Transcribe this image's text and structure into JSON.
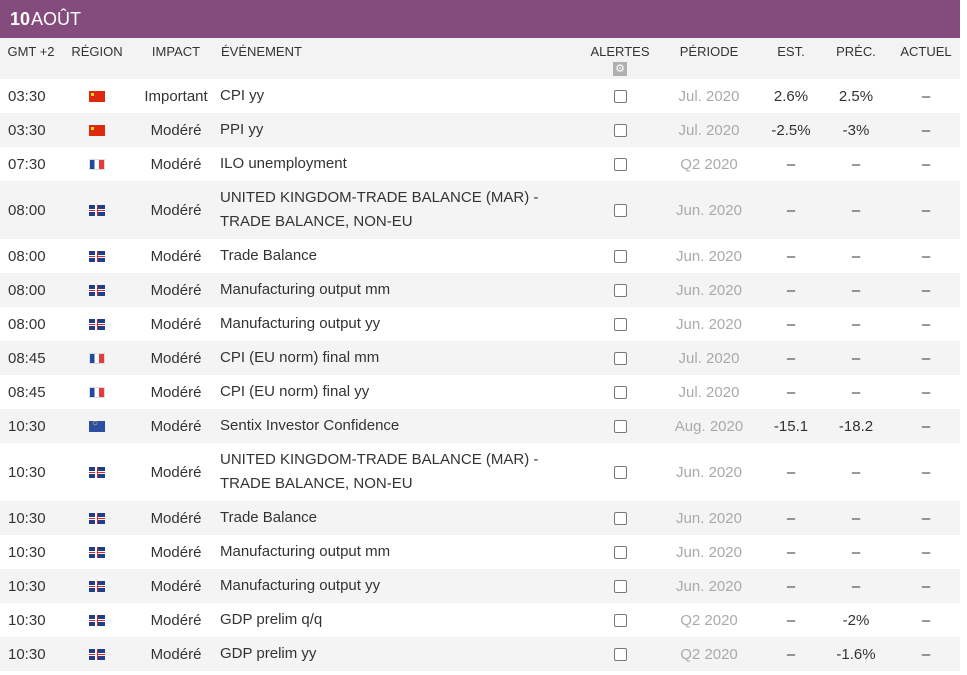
{
  "date": {
    "day": "10",
    "month": "AOÛT"
  },
  "headers": {
    "time": "GMT +2",
    "region": "RÉGION",
    "impact": "IMPACT",
    "event": "ÉVÉNEMENT",
    "alerts": "ALERTES",
    "period": "PÉRIODE",
    "est": "EST.",
    "prev": "PRÉC.",
    "actual": "ACTUEL"
  },
  "rows": [
    {
      "time": "03:30",
      "flag": "cn",
      "impact": "Important",
      "event": "CPI yy",
      "period": "Jul. 2020",
      "est": "2.6%",
      "prev": "2.5%",
      "actual": "–"
    },
    {
      "time": "03:30",
      "flag": "cn",
      "impact": "Modéré",
      "event": "PPI yy",
      "period": "Jul. 2020",
      "est": "-2.5%",
      "prev": "-3%",
      "actual": "–"
    },
    {
      "time": "07:30",
      "flag": "fr",
      "impact": "Modéré",
      "event": "ILO unemployment",
      "period": "Q2 2020",
      "est": "–",
      "prev": "–",
      "actual": "–"
    },
    {
      "time": "08:00",
      "flag": "gb",
      "impact": "Modéré",
      "event": "UNITED KINGDOM-TRADE BALANCE (MAR) - TRADE BALANCE, NON-EU",
      "period": "Jun. 2020",
      "est": "–",
      "prev": "–",
      "actual": "–",
      "tall": true
    },
    {
      "time": "08:00",
      "flag": "gb",
      "impact": "Modéré",
      "event": "Trade Balance",
      "period": "Jun. 2020",
      "est": "–",
      "prev": "–",
      "actual": "–"
    },
    {
      "time": "08:00",
      "flag": "gb",
      "impact": "Modéré",
      "event": "Manufacturing output mm",
      "period": "Jun. 2020",
      "est": "–",
      "prev": "–",
      "actual": "–"
    },
    {
      "time": "08:00",
      "flag": "gb",
      "impact": "Modéré",
      "event": "Manufacturing output yy",
      "period": "Jun. 2020",
      "est": "–",
      "prev": "–",
      "actual": "–"
    },
    {
      "time": "08:45",
      "flag": "fr",
      "impact": "Modéré",
      "event": "CPI (EU norm) final mm",
      "period": "Jul. 2020",
      "est": "–",
      "prev": "–",
      "actual": "–"
    },
    {
      "time": "08:45",
      "flag": "fr",
      "impact": "Modéré",
      "event": "CPI (EU norm) final yy",
      "period": "Jul. 2020",
      "est": "–",
      "prev": "–",
      "actual": "–"
    },
    {
      "time": "10:30",
      "flag": "eu",
      "impact": "Modéré",
      "event": "Sentix Investor Confidence",
      "period": "Aug. 2020",
      "est": "-15.1",
      "prev": "-18.2",
      "actual": "–"
    },
    {
      "time": "10:30",
      "flag": "gb",
      "impact": "Modéré",
      "event": "UNITED KINGDOM-TRADE BALANCE (MAR) - TRADE BALANCE, NON-EU",
      "period": "Jun. 2020",
      "est": "–",
      "prev": "–",
      "actual": "–",
      "tall": true
    },
    {
      "time": "10:30",
      "flag": "gb",
      "impact": "Modéré",
      "event": "Trade Balance",
      "period": "Jun. 2020",
      "est": "–",
      "prev": "–",
      "actual": "–"
    },
    {
      "time": "10:30",
      "flag": "gb",
      "impact": "Modéré",
      "event": "Manufacturing output mm",
      "period": "Jun. 2020",
      "est": "–",
      "prev": "–",
      "actual": "–"
    },
    {
      "time": "10:30",
      "flag": "gb",
      "impact": "Modéré",
      "event": "Manufacturing output yy",
      "period": "Jun. 2020",
      "est": "–",
      "prev": "–",
      "actual": "–"
    },
    {
      "time": "10:30",
      "flag": "gb",
      "impact": "Modéré",
      "event": "GDP prelim q/q",
      "period": "Q2 2020",
      "est": "–",
      "prev": "-2%",
      "actual": "–"
    },
    {
      "time": "10:30",
      "flag": "gb",
      "impact": "Modéré",
      "event": "GDP prelim yy",
      "period": "Q2 2020",
      "est": "–",
      "prev": "-1.6%",
      "actual": "–"
    }
  ],
  "colors": {
    "header_bar": "#834c7d",
    "row_alt": "#f4f4f4",
    "period_text": "#aaaaaa"
  },
  "icons": {
    "alerts_settings": "gear-icon"
  }
}
